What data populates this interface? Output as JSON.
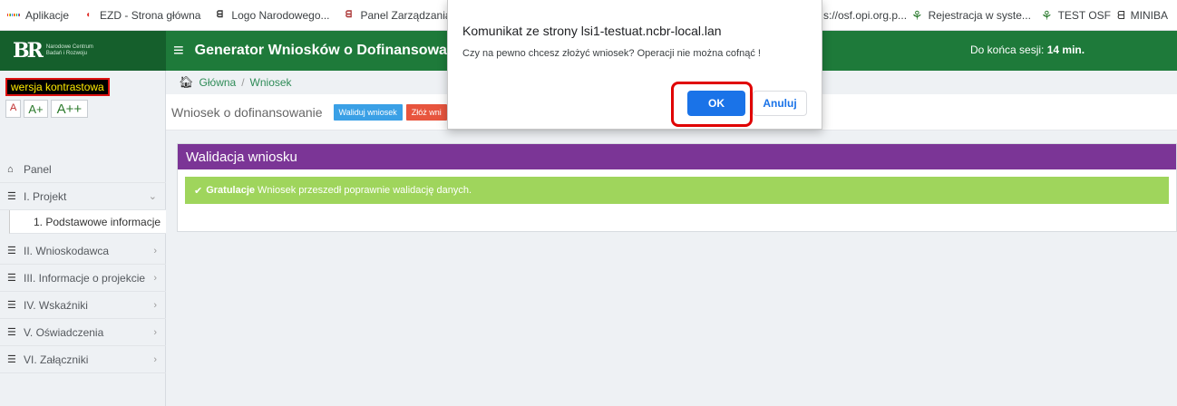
{
  "bookmarks": {
    "apps_label": "Aplikacje",
    "items": [
      {
        "label": "EZD - Strona główna",
        "icon": "ezd-icon"
      },
      {
        "label": "Logo Narodowego...",
        "icon": "ncbr-icon"
      },
      {
        "label": "Panel Zarządzania...",
        "icon": "panel-icon"
      }
    ],
    "right_items": [
      {
        "label": "s://osf.opi.org.p..."
      },
      {
        "label": "Rejestracja w syste...",
        "icon": "osf-icon"
      },
      {
        "label": "TEST OSF",
        "icon": "osf-icon"
      },
      {
        "label": "MINIBA",
        "icon": "ncbr-icon"
      }
    ]
  },
  "header": {
    "logo_mark": "BR",
    "logo_text": "Narodowe Centrum Badań i Rozwoju",
    "title": "Generator Wniosków o Dofinansowanie",
    "session_label": "Do końca sesji:",
    "session_value": "14 min."
  },
  "sidebar": {
    "contrast_label": "wersja kontrastowa",
    "font_small": "A",
    "font_medium": "A+",
    "font_large": "A++",
    "items": [
      {
        "label": "Panel",
        "icon": "home-icon"
      },
      {
        "label": "I. Projekt",
        "icon": "list-icon"
      },
      {
        "label": "1. Podstawowe informacje"
      },
      {
        "label": "II. Wnioskodawca",
        "icon": "list-icon"
      },
      {
        "label": "III. Informacje o projekcie",
        "icon": "list-icon"
      },
      {
        "label": "IV. Wskaźniki",
        "icon": "list-icon"
      },
      {
        "label": "V. Oświadczenia",
        "icon": "list-icon"
      },
      {
        "label": "VI. Załączniki",
        "icon": "list-icon"
      }
    ]
  },
  "breadcrumb": {
    "home": "Główna",
    "current": "Wniosek"
  },
  "page": {
    "title": "Wniosek o dofinansowanie",
    "validate_btn": "Waliduj wniosek",
    "submit_btn": "Złóż wni"
  },
  "panel": {
    "title": "Walidacja wniosku",
    "alert_bold": "Gratulacje",
    "alert_text": "Wniosek przeszedł poprawnie walidację danych."
  },
  "dialog": {
    "title": "Komunikat ze strony lsi1-testuat.ncbr-local.lan",
    "message": "Czy na pewno chcesz złożyć wniosek? Operacji nie można cofnąć !",
    "ok": "OK",
    "cancel": "Anuluj"
  },
  "colors": {
    "header_green": "#1e7a3a",
    "panel_purple": "#7b3596",
    "alert_green": "#9fd55c",
    "dialog_blue": "#1a73e8",
    "highlight_red": "#e00000"
  }
}
